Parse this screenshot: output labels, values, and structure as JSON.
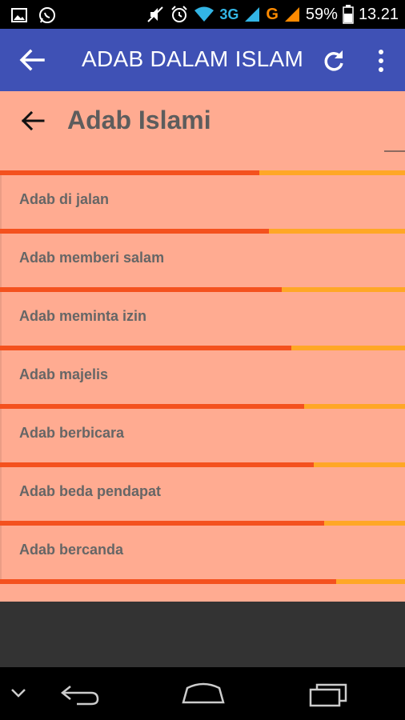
{
  "status_bar": {
    "network_3g": "3G",
    "network_g": "G",
    "battery": "59%",
    "time": "13.21"
  },
  "app_bar": {
    "title": "ADAB DALAM ISLAM",
    "icons": [
      "arrow-back-icon",
      "refresh-icon",
      "more-vert-icon"
    ]
  },
  "page": {
    "title": "Adab Islami"
  },
  "list": {
    "items": [
      {
        "label": "Adab di jalan",
        "progress": 0.64
      },
      {
        "label": "Adab memberi salam",
        "progress": 0.665
      },
      {
        "label": "Adab meminta izin",
        "progress": 0.695
      },
      {
        "label": "Adab majelis",
        "progress": 0.72
      },
      {
        "label": "Adab berbicara",
        "progress": 0.75
      },
      {
        "label": "Adab beda pendapat",
        "progress": 0.775
      },
      {
        "label": "Adab bercanda",
        "progress": 0.8
      }
    ],
    "final_progress": 0.83
  },
  "colors": {
    "app_bar": "#3f51b5",
    "content_bg": "#ffab91",
    "progress_fill": "#f4511e",
    "progress_track": "#ffa726"
  }
}
